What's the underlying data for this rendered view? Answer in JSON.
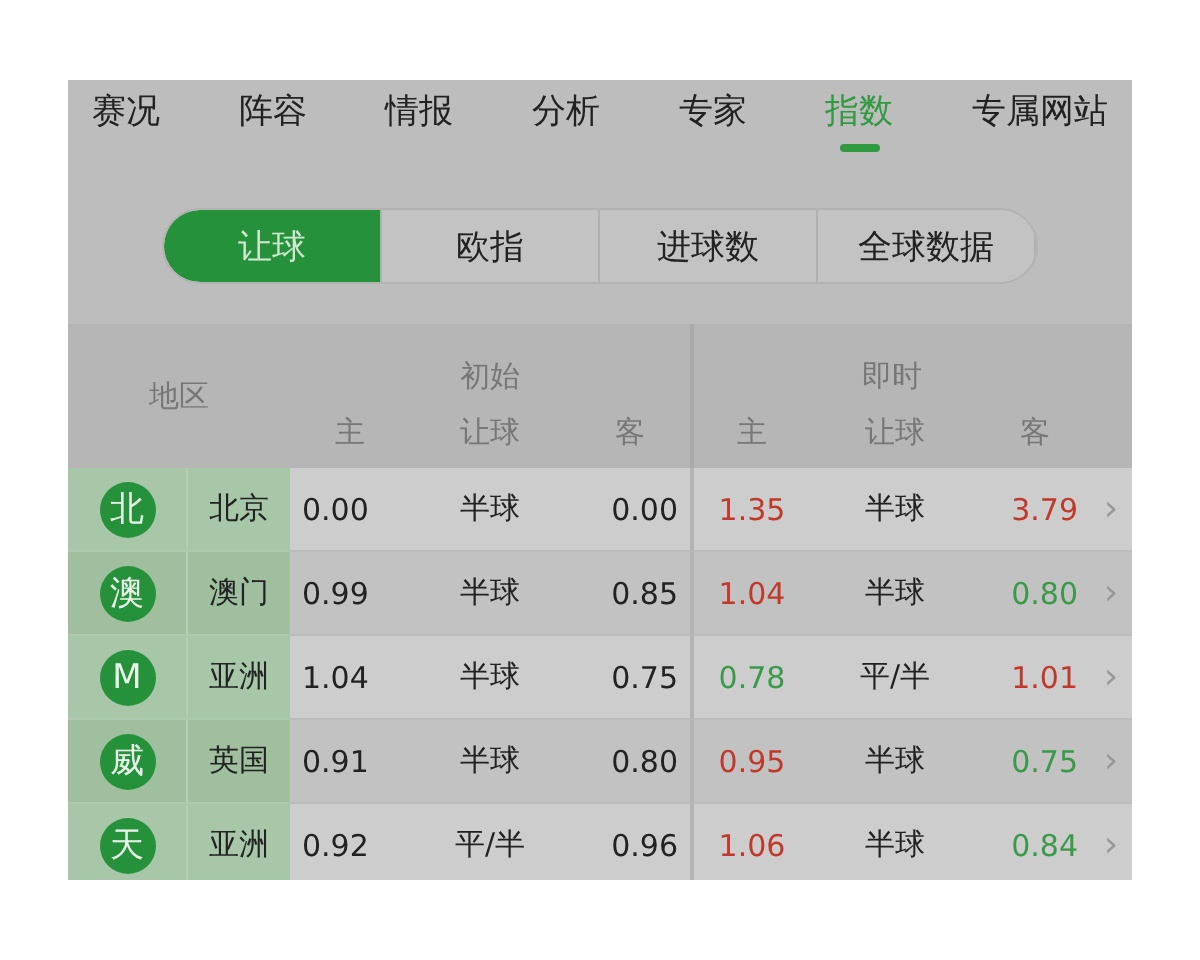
{
  "tabs": [
    {
      "label": "赛况",
      "selected": false
    },
    {
      "label": "阵容",
      "selected": false
    },
    {
      "label": "情报",
      "selected": false
    },
    {
      "label": "分析",
      "selected": false
    },
    {
      "label": "专家",
      "selected": false
    },
    {
      "label": "指数",
      "selected": true
    },
    {
      "label": "专属网站",
      "selected": false
    }
  ],
  "segments": [
    {
      "label": "让球",
      "selected": true
    },
    {
      "label": "欧指",
      "selected": false
    },
    {
      "label": "进球数",
      "selected": false
    },
    {
      "label": "全球数据",
      "selected": false
    }
  ],
  "table": {
    "region_header": "地区",
    "initial_header": "初始",
    "live_header": "即时",
    "sub_headers": [
      "主",
      "让球",
      "客",
      "主",
      "让球",
      "客"
    ],
    "rows": [
      {
        "badge": "北",
        "region": "北京",
        "initial": [
          "0.00",
          "半球",
          "0.00"
        ],
        "live_home": {
          "value": "1.35",
          "color": "#c0392b"
        },
        "live_line": "半球",
        "live_away": {
          "value": "3.79",
          "color": "#c0392b"
        },
        "chevron": "›"
      },
      {
        "badge": "澳",
        "region": "澳门",
        "initial": [
          "0.99",
          "半球",
          "0.85"
        ],
        "live_home": {
          "value": "1.04",
          "color": "#c0392b"
        },
        "live_line": "半球",
        "live_away": {
          "value": "0.80",
          "color": "#3a9a4a"
        },
        "chevron": "›"
      },
      {
        "badge": "M",
        "region": "亚洲",
        "initial": [
          "1.04",
          "半球",
          "0.75"
        ],
        "live_home": {
          "value": "0.78",
          "color": "#3a9a4a"
        },
        "live_line": "平/半",
        "live_away": {
          "value": "1.01",
          "color": "#c0392b"
        },
        "chevron": "›"
      },
      {
        "badge": "威",
        "region": "英国",
        "initial": [
          "0.91",
          "半球",
          "0.80"
        ],
        "live_home": {
          "value": "0.95",
          "color": "#c0392b"
        },
        "live_line": "半球",
        "live_away": {
          "value": "0.75",
          "color": "#3a9a4a"
        },
        "chevron": "›"
      },
      {
        "badge": "天",
        "region": "亚洲",
        "initial": [
          "0.92",
          "平/半",
          "0.96"
        ],
        "live_home": {
          "value": "1.06",
          "color": "#c0392b"
        },
        "live_line": "半球",
        "live_away": {
          "value": "0.84",
          "color": "#3a9a4a"
        },
        "chevron": "›"
      }
    ]
  }
}
